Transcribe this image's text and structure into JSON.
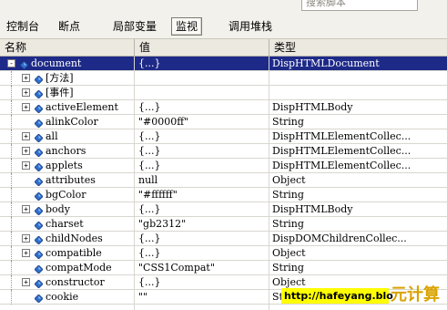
{
  "search": {
    "placeholder": "搜索脚本"
  },
  "tabs": [
    {
      "label": "控制台",
      "active": false
    },
    {
      "label": "断点",
      "active": false
    },
    {
      "label": "局部变量",
      "active": false
    },
    {
      "label": "监视",
      "active": true
    },
    {
      "label": "调用堆栈",
      "active": false
    }
  ],
  "columns": {
    "name": "名称",
    "value": "值",
    "type": "类型"
  },
  "rows": [
    {
      "name": "document",
      "value": "{...}",
      "type": "DispHTMLDocument",
      "expander": "minus",
      "level": 0,
      "selected": true
    },
    {
      "name": "[方法]",
      "value": "",
      "type": "",
      "expander": "plus",
      "level": 1,
      "selected": false
    },
    {
      "name": "[事件]",
      "value": "",
      "type": "",
      "expander": "plus",
      "level": 1,
      "selected": false
    },
    {
      "name": "activeElement",
      "value": "{...}",
      "type": "DispHTMLBody",
      "expander": "plus",
      "level": 1,
      "selected": false
    },
    {
      "name": "alinkColor",
      "value": "\"#0000ff\"",
      "type": "String",
      "expander": "none",
      "level": 1,
      "selected": false
    },
    {
      "name": "all",
      "value": "{...}",
      "type": "DispHTMLElementCollec...",
      "expander": "plus",
      "level": 1,
      "selected": false
    },
    {
      "name": "anchors",
      "value": "{...}",
      "type": "DispHTMLElementCollec...",
      "expander": "plus",
      "level": 1,
      "selected": false
    },
    {
      "name": "applets",
      "value": "{...}",
      "type": "DispHTMLElementCollec...",
      "expander": "plus",
      "level": 1,
      "selected": false
    },
    {
      "name": "attributes",
      "value": "null",
      "type": "Object",
      "expander": "none",
      "level": 1,
      "selected": false
    },
    {
      "name": "bgColor",
      "value": "\"#ffffff\"",
      "type": "String",
      "expander": "none",
      "level": 1,
      "selected": false
    },
    {
      "name": "body",
      "value": "{...}",
      "type": "DispHTMLBody",
      "expander": "plus",
      "level": 1,
      "selected": false
    },
    {
      "name": "charset",
      "value": "\"gb2312\"",
      "type": "String",
      "expander": "none",
      "level": 1,
      "selected": false
    },
    {
      "name": "childNodes",
      "value": "{...}",
      "type": "DispDOMChildrenCollec...",
      "expander": "plus",
      "level": 1,
      "selected": false
    },
    {
      "name": "compatible",
      "value": "{...}",
      "type": "Object",
      "expander": "plus",
      "level": 1,
      "selected": false
    },
    {
      "name": "compatMode",
      "value": "\"CSS1Compat\"",
      "type": "String",
      "expander": "none",
      "level": 1,
      "selected": false
    },
    {
      "name": "constructor",
      "value": "{...}",
      "type": "Object",
      "expander": "plus",
      "level": 1,
      "selected": false
    },
    {
      "name": "cookie",
      "value": "\"\"",
      "type": "String",
      "expander": "none",
      "level": 1,
      "selected": false
    }
  ],
  "watermark": {
    "text": "http://hafeyang.blo"
  },
  "logo": {
    "text": "元计算"
  },
  "colors": {
    "selected_bg": "#1e2a88",
    "icon_blue": "#2f6fcf",
    "watermark_bg": "#ffff00"
  }
}
